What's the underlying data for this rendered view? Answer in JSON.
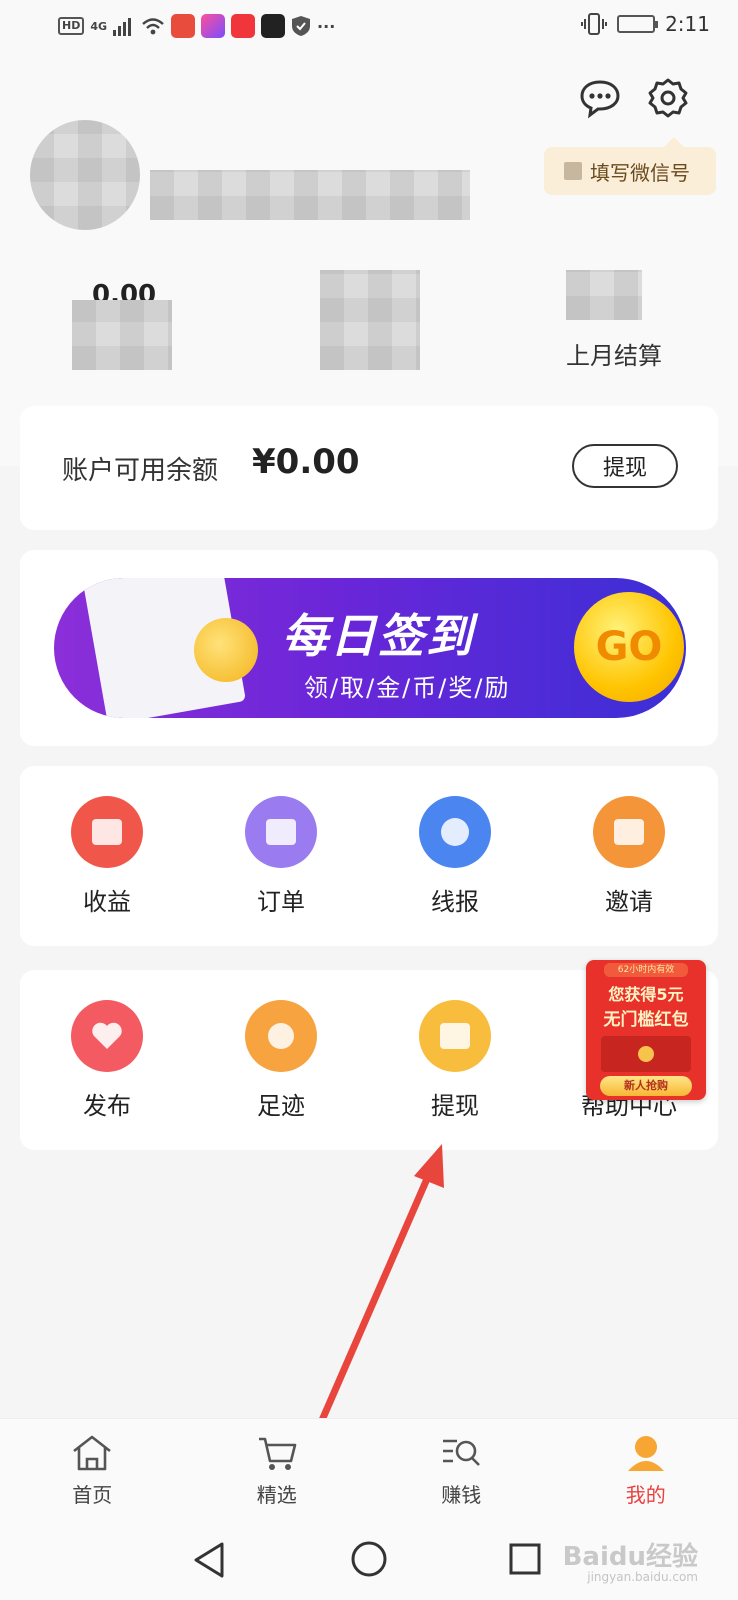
{
  "status_bar": {
    "hd": "HD",
    "network": "4G",
    "more": "···",
    "time": "2:11"
  },
  "header": {
    "wechat_tag": "填写微信号",
    "stats": [
      {
        "value": "0.00",
        "label": ""
      },
      {
        "value": "",
        "label": ""
      },
      {
        "value": "",
        "label": "上月结算"
      }
    ]
  },
  "balance": {
    "label": "账户可用余额",
    "value": "¥0.00",
    "withdraw": "提现"
  },
  "banner": {
    "title": "每日签到",
    "subtitle": "领/取/金/币/奖/励",
    "go": "GO"
  },
  "grid1": [
    {
      "label": "收益",
      "icon": "income-icon",
      "color": "#f0574a"
    },
    {
      "label": "订单",
      "icon": "order-icon",
      "color": "#9a7cf0"
    },
    {
      "label": "线报",
      "icon": "news-icon",
      "color": "#4b86f0"
    },
    {
      "label": "邀请",
      "icon": "gift-icon",
      "color": "#f5953a"
    }
  ],
  "grid2": [
    {
      "label": "发布",
      "icon": "heart-icon",
      "color": "#f35a61"
    },
    {
      "label": "足迹",
      "icon": "footprint-icon",
      "color": "#f7a340"
    },
    {
      "label": "提现",
      "icon": "wallet-icon",
      "color": "#f9bd3e"
    },
    {
      "label": "帮助中心",
      "icon": "help-icon",
      "color": "#f08a4a"
    }
  ],
  "promo": {
    "top": "62小时内有效",
    "line1": "您获得5元",
    "line2": "无门槛红包",
    "button": "新人抢购"
  },
  "tabs": [
    {
      "label": "首页",
      "icon": "home-icon"
    },
    {
      "label": "精选",
      "icon": "cart-icon"
    },
    {
      "label": "赚钱",
      "icon": "search-list-icon"
    },
    {
      "label": "我的",
      "icon": "profile-icon"
    }
  ],
  "watermark": {
    "text": "Baidu经验",
    "url": "jingyan.baidu.com"
  },
  "colors": {
    "accent": "#e8423f",
    "banner": "#6a26d8"
  }
}
